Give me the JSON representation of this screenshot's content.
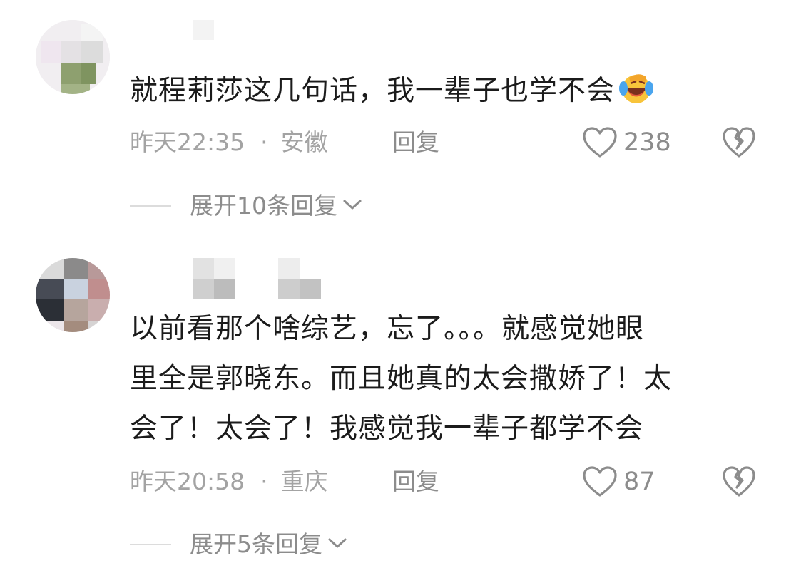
{
  "comments": [
    {
      "text": "就程莉莎这几句话，我一辈子也学不会",
      "emoji_icon": "laughing-crying-emoji-icon",
      "time": "昨天22:35",
      "separator": "·",
      "location": "安徽",
      "reply_label": "回复",
      "like_count": "238",
      "expand_label": "展开10条回复"
    },
    {
      "text_lines": [
        "以前看那个啥综艺，忘了。。。就感觉她眼",
        "里全是郭晓东。而且她真的太会撒娇了！太",
        "会了！太会了！我感觉我一辈子都学不会"
      ],
      "time": "昨天20:58",
      "separator": "·",
      "location": "重庆",
      "reply_label": "回复",
      "like_count": "87",
      "expand_label": "展开5条回复"
    }
  ],
  "colors": {
    "text": "#1b1b1b",
    "meta": "#a3a3a3",
    "action": "#8c8c8c",
    "divider": "#dcdcdc"
  }
}
